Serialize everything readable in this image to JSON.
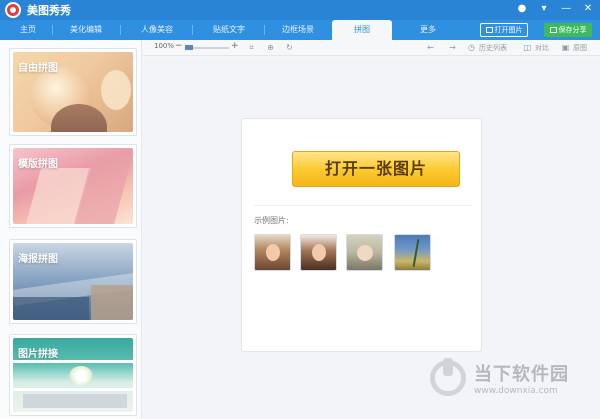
{
  "app": {
    "title": "美图秀秀"
  },
  "nav": {
    "tabs": [
      "主页",
      "美化编辑",
      "人像美容",
      "贴纸文字",
      "边框场景",
      "拼图",
      "更多"
    ],
    "active": "拼图",
    "open_label": "打开图片",
    "save_label": "保存分享"
  },
  "sidebar": {
    "items": [
      {
        "label": "自由拼图"
      },
      {
        "label": "模版拼图"
      },
      {
        "label": "海报拼图"
      },
      {
        "label": "图片拼接"
      }
    ]
  },
  "toolbar": {
    "zoom": "100%",
    "history_label": "历史列表",
    "compare_label": "对比",
    "original_label": "原图"
  },
  "main": {
    "open_image_label": "打开一张图片",
    "sample_label": "示例图片:"
  },
  "watermark": {
    "title": "当下软件园",
    "url": "www.downxia.com"
  },
  "colors": {
    "brand_blue": "#2a84d6",
    "save_green": "#3dbb5c",
    "open_yellow": "#fcc92d"
  }
}
